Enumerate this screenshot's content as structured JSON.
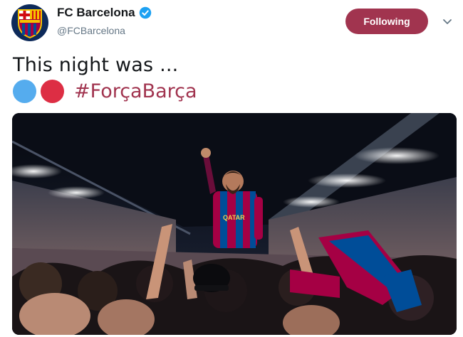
{
  "account": {
    "display_name": "FC Barcelona",
    "handle": "@FCBarcelona",
    "verified": true,
    "avatar_icon": "fc-barcelona-crest-icon"
  },
  "follow_button": {
    "label": "Following",
    "color": "#a1344f"
  },
  "menu": {
    "icon": "chevron-down-icon"
  },
  "tweet": {
    "text": "This night was ...",
    "emoji": [
      {
        "name": "blue-circle-icon",
        "color": "#55acee"
      },
      {
        "name": "red-circle-icon",
        "color": "#dd2e44"
      }
    ],
    "hashtag": "#ForçaBarça",
    "hashtag_color": "#a1344f"
  },
  "media": {
    "description_icon": "stadium-celebration-photo",
    "jersey_text": "QATAR"
  }
}
